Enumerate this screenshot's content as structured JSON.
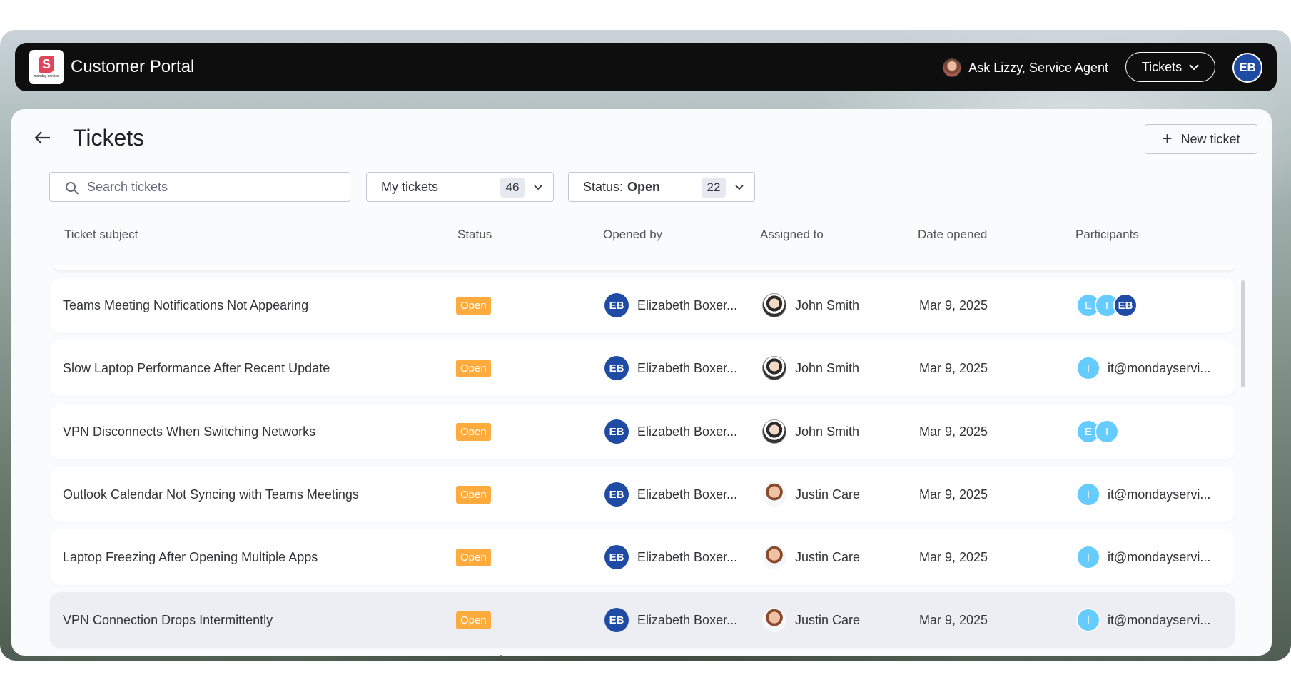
{
  "app": {
    "title": "Customer Portal",
    "logo_text": "monday service",
    "agent_label": "Ask Lizzy, Service Agent",
    "tickets_menu_label": "Tickets",
    "user_initials": "EB"
  },
  "page": {
    "title": "Tickets",
    "new_ticket_label": "New ticket"
  },
  "filters": {
    "search_placeholder": "Search tickets",
    "my_tickets_label": "My tickets",
    "my_tickets_count": "46",
    "status_label": "Status:",
    "status_value": "Open",
    "status_count": "22"
  },
  "table": {
    "headers": [
      "Ticket subject",
      "Status",
      "Opened by",
      "Assigned to",
      "Date opened",
      "Participants"
    ],
    "rows": [
      {
        "subject": "Teams Meeting Notifications Not Appearing",
        "status": "Open",
        "opened_initials": "EB",
        "opened_by": "Elizabeth Boxer...",
        "assigned_to": "John Smith",
        "date": "Mar 9, 2025",
        "participant_dots": [
          "E",
          "I",
          "EB"
        ],
        "participant_email": ""
      },
      {
        "subject": "Slow Laptop Performance After Recent Update",
        "status": "Open",
        "opened_initials": "EB",
        "opened_by": "Elizabeth Boxer...",
        "assigned_to": "John Smith",
        "date": "Mar 9, 2025",
        "participant_dots": [
          "I"
        ],
        "participant_email": "it@mondayservi..."
      },
      {
        "subject": "VPN Disconnects When Switching Networks",
        "status": "Open",
        "opened_initials": "EB",
        "opened_by": "Elizabeth Boxer...",
        "assigned_to": "John Smith",
        "date": "Mar 9, 2025",
        "participant_dots": [
          "E",
          "I"
        ],
        "participant_email": ""
      },
      {
        "subject": "Outlook Calendar Not Syncing with Teams Meetings",
        "status": "Open",
        "opened_initials": "EB",
        "opened_by": "Elizabeth Boxer...",
        "assigned_to": "Justin Care",
        "date": "Mar 9, 2025",
        "participant_dots": [
          "I"
        ],
        "participant_email": "it@mondayservi..."
      },
      {
        "subject": "Laptop Freezing After Opening Multiple Apps",
        "status": "Open",
        "opened_initials": "EB",
        "opened_by": "Elizabeth Boxer...",
        "assigned_to": "Justin Care",
        "date": "Mar 9, 2025",
        "participant_dots": [
          "I"
        ],
        "participant_email": "it@mondayservi..."
      },
      {
        "subject": "VPN Connection Drops Intermittently",
        "status": "Open",
        "opened_initials": "EB",
        "opened_by": "Elizabeth Boxer...",
        "assigned_to": "Justin Care",
        "date": "Mar 9, 2025",
        "participant_dots": [
          "I"
        ],
        "participant_email": "it@mondayservi..."
      }
    ]
  },
  "colors": {
    "status_open": "#fdab3d",
    "avatar_eb": "#1f4ba5",
    "participant_blue": "#66ccff",
    "topbar": "#0e0e0f"
  },
  "icons": [
    "back-arrow-icon",
    "plus-icon",
    "search-icon",
    "chevron-down-icon",
    "pointer-cursor-icon"
  ]
}
